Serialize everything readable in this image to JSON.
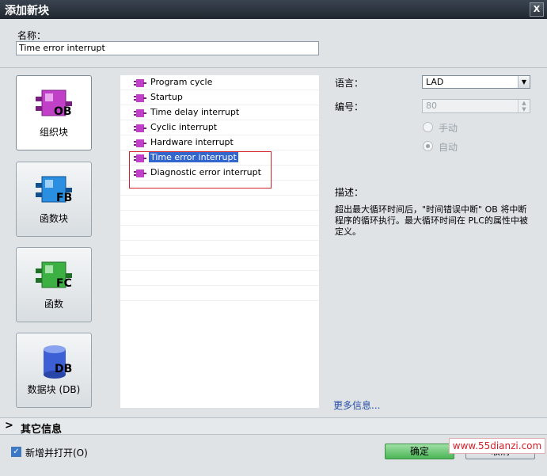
{
  "window": {
    "title": "添加新块",
    "close_label": "X"
  },
  "name_field": {
    "label": "名称：",
    "value": "Time error interrupt"
  },
  "block_types": [
    {
      "label": "组织块",
      "abbr": "OB",
      "color": "#c040c8"
    },
    {
      "label": "函数块",
      "abbr": "FB",
      "color": "#2a8fe0"
    },
    {
      "label": "函数",
      "abbr": "FC",
      "color": "#3cb043"
    },
    {
      "label": "数据块 (DB)",
      "abbr": "DB",
      "color": "#3c5fd6"
    }
  ],
  "ob_list": [
    {
      "label": "Program cycle",
      "selected": false
    },
    {
      "label": "Startup",
      "selected": false
    },
    {
      "label": "Time delay interrupt",
      "selected": false
    },
    {
      "label": "Cyclic interrupt",
      "selected": false
    },
    {
      "label": "Hardware interrupt",
      "selected": false
    },
    {
      "label": "Time error interrupt",
      "selected": true
    },
    {
      "label": "Diagnostic error interrupt",
      "selected": false
    }
  ],
  "properties": {
    "language_label": "语言：",
    "language_value": "LAD",
    "number_label": "编号：",
    "number_value": "80",
    "manual_label": "手动",
    "auto_label": "自动",
    "auto_selected": true
  },
  "description": {
    "label": "描述：",
    "text": "超出最大循环时间后，\"时间错误中断\" OB 将中断程序的循环执行。最大循环时间在 PLC的属性中被定义。",
    "more_info": "更多信息..."
  },
  "other_info": {
    "chevron": ">",
    "label": "其它信息"
  },
  "footer": {
    "add_open_label": "新增并打开(O)",
    "add_open_checked": true,
    "ok_label": "确定",
    "cancel_label": "取消",
    "watermark": "www.55dianzi.com"
  },
  "colors": {
    "accent": "#3366cc",
    "highlight_box": "#d4202a"
  }
}
